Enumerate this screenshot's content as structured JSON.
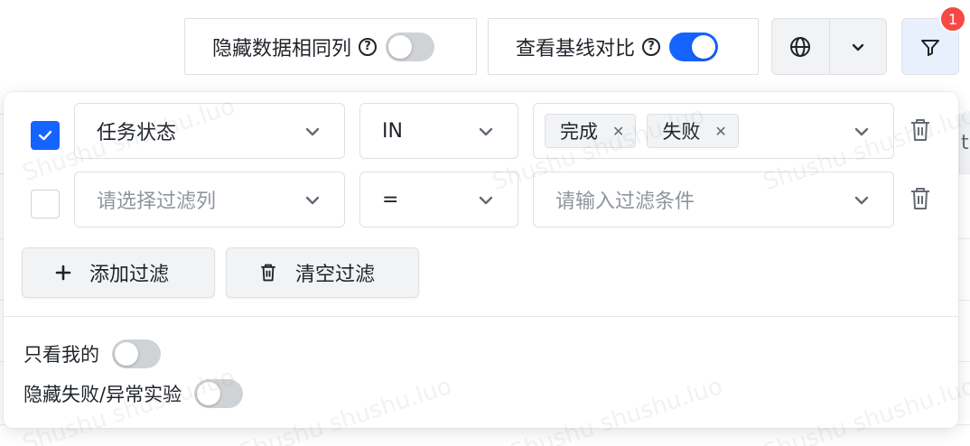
{
  "toolbar": {
    "hide_same_columns_label": "隐藏数据相同列",
    "hide_same_columns_on": false,
    "baseline_compare_label": "查看基线对比",
    "baseline_compare_on": true,
    "filter_badge_count": "1"
  },
  "background": {
    "right_column_fragment": "ti"
  },
  "filters": [
    {
      "checked": true,
      "column_value": "任务状态",
      "operator": "IN",
      "tags": [
        "完成",
        "失败"
      ]
    },
    {
      "checked": false,
      "column_placeholder": "请选择过滤列",
      "operator": "=",
      "value_placeholder": "请输入过滤条件"
    }
  ],
  "actions": {
    "add_filter_label": "添加过滤",
    "clear_filter_label": "清空过滤"
  },
  "options": {
    "only_mine_label": "只看我的",
    "only_mine_on": false,
    "hide_failed_label": "隐藏失败/异常实验",
    "hide_failed_on": false
  },
  "watermark_text": "Shushu shushu.luo",
  "colors": {
    "accent": "#1664ff",
    "badge": "#f54a45",
    "filter_button_bg": "#e8f0fe"
  }
}
